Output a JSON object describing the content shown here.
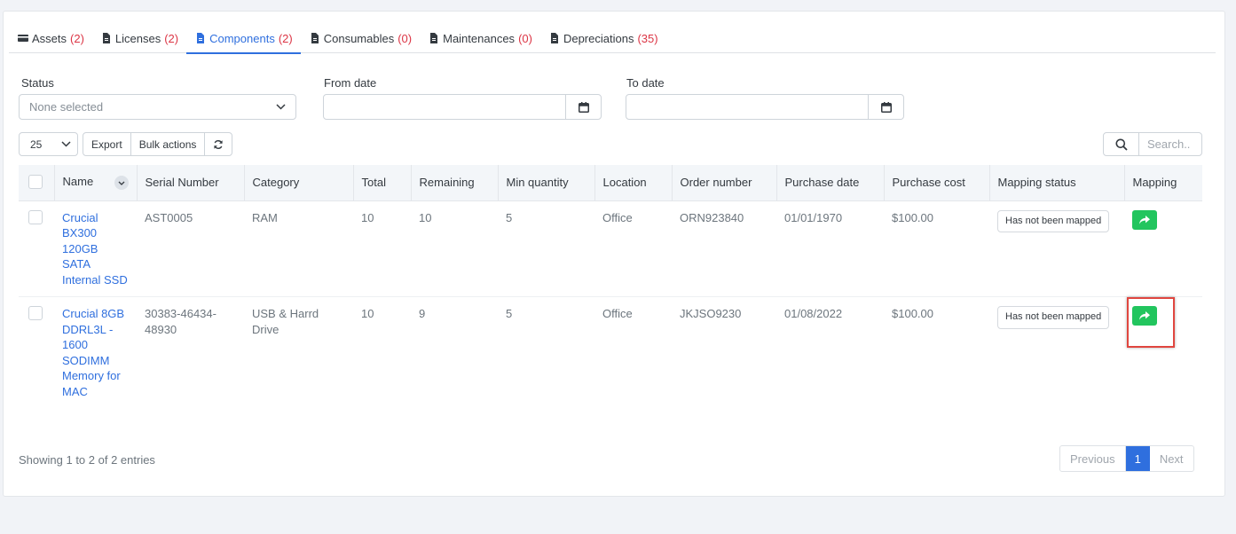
{
  "tabs": [
    {
      "label": "Assets",
      "count": "(2)",
      "icon": "credit-card-icon"
    },
    {
      "label": "Licenses",
      "count": "(2)",
      "icon": "file-icon"
    },
    {
      "label": "Components",
      "count": "(2)",
      "icon": "file-icon",
      "active": true
    },
    {
      "label": "Consumables",
      "count": "(0)",
      "icon": "file-icon"
    },
    {
      "label": "Maintenances",
      "count": "(0)",
      "icon": "file-icon"
    },
    {
      "label": "Depreciations",
      "count": "(35)",
      "icon": "file-icon"
    }
  ],
  "filters": {
    "status_label": "Status",
    "status_placeholder": "None selected",
    "from_label": "From date",
    "from_value": "",
    "to_label": "To date",
    "to_value": ""
  },
  "toolbar": {
    "page_size": "25",
    "export_label": "Export",
    "bulk_label": "Bulk actions",
    "search_placeholder": "Search.."
  },
  "table": {
    "headers": [
      "Name",
      "Serial Number",
      "Category",
      "Total",
      "Remaining",
      "Min quantity",
      "Location",
      "Order number",
      "Purchase date",
      "Purchase cost",
      "Mapping status",
      "Mapping"
    ],
    "rows": [
      {
        "name": "Crucial BX300 120GB SATA Internal SSD",
        "serial": "AST0005",
        "category": "RAM",
        "total": "10",
        "remaining": "10",
        "min_qty": "5",
        "location": "Office",
        "order": "ORN923840",
        "purchase_date": "01/01/1970",
        "cost": "$100.00",
        "mapping_status": "Has not been mapped"
      },
      {
        "name": "Crucial 8GB DDRL3L - 1600 SODIMM Memory for MAC",
        "serial": "30383-46434-48930",
        "category": "USB & Harrd Drive",
        "total": "10",
        "remaining": "9",
        "min_qty": "5",
        "location": "Office",
        "order": "JKJSO9230",
        "purchase_date": "01/08/2022",
        "cost": "$100.00",
        "mapping_status": "Has not been mapped"
      }
    ]
  },
  "footer": {
    "showing": "Showing 1 to 2 of 2 entries",
    "prev": "Previous",
    "page": "1",
    "next": "Next"
  },
  "colors": {
    "accent": "#2f6fde",
    "count": "#dc3545",
    "map_button": "#22c55e",
    "highlight": "#e0463f"
  }
}
